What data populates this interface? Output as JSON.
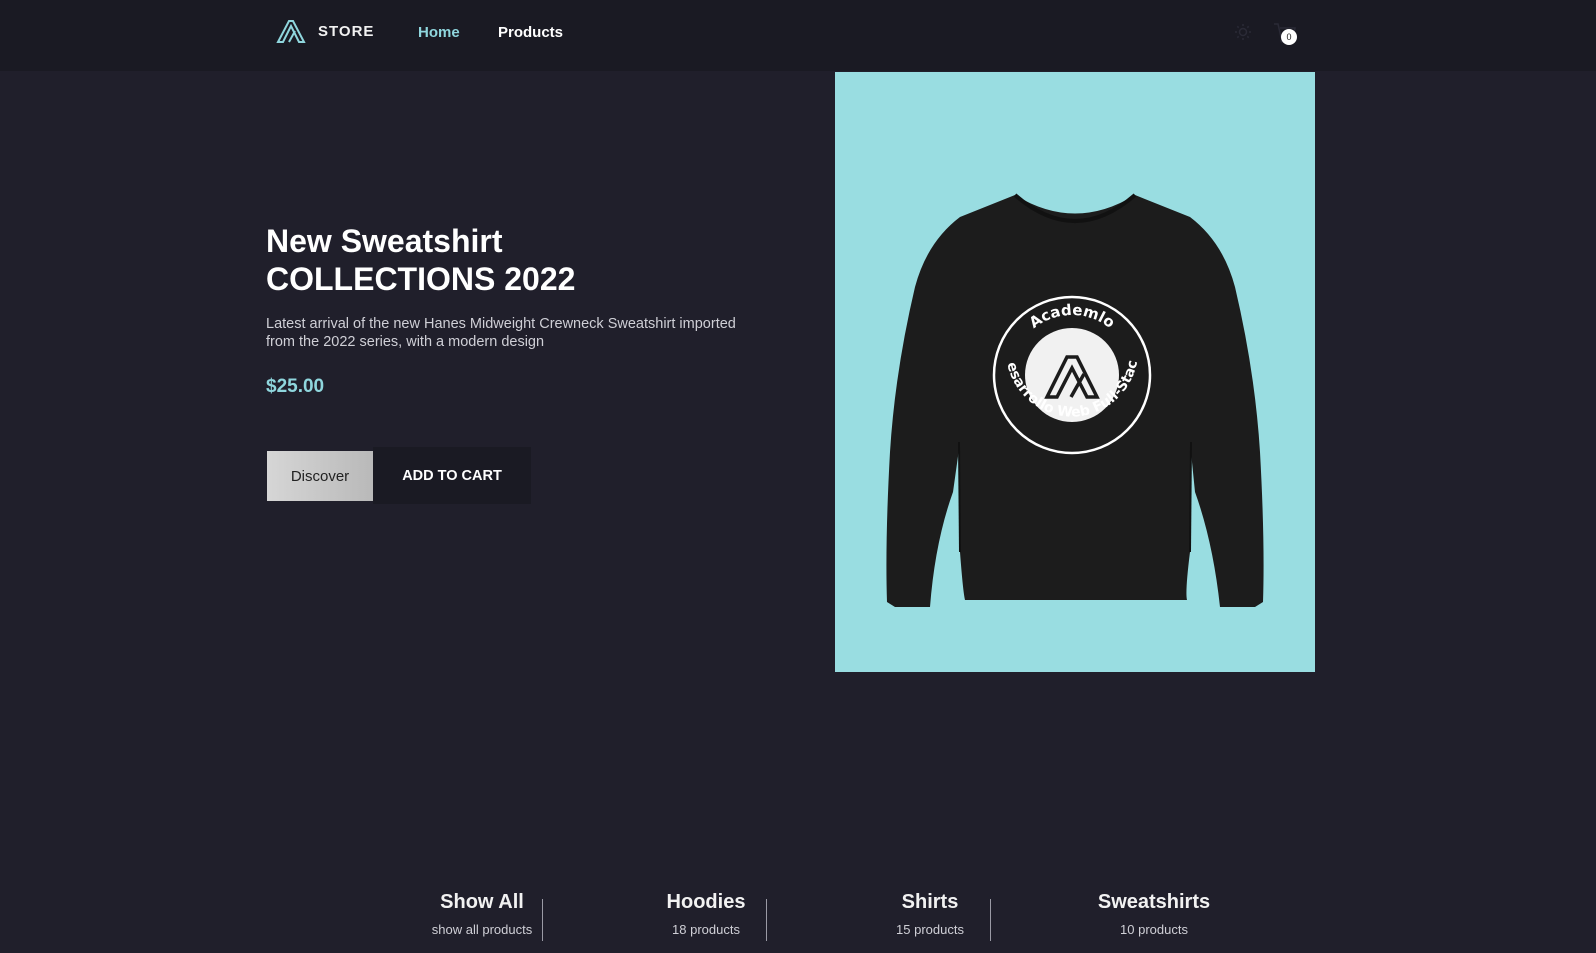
{
  "header": {
    "brand": "STORE",
    "nav": {
      "home": "Home",
      "products": "Products"
    },
    "cart_count": "0",
    "icons": [
      "logo-icon",
      "sun-icon",
      "cart-icon"
    ],
    "accent_color": "#8fd6dd"
  },
  "hero": {
    "title_line1": "New Sweatshirt",
    "title_line2": "COLLECTIONS 2022",
    "description": "Latest arrival of the new Hanes Midweight Crewneck Sweatshirt imported from the 2022 series, with a modern design",
    "price": "$25.00",
    "discover_label": "Discover",
    "add_to_cart_label": "ADD TO CART",
    "image": {
      "background_color": "#99dde1",
      "print_top_text": "Academlo",
      "print_bottom_text": "Desarrollo Web Full-Stack"
    }
  },
  "categories": [
    {
      "name": "Show All",
      "count": "show all products"
    },
    {
      "name": "Hoodies",
      "count": "18 products"
    },
    {
      "name": "Shirts",
      "count": "15 products"
    },
    {
      "name": "Sweatshirts",
      "count": "10 products"
    }
  ]
}
